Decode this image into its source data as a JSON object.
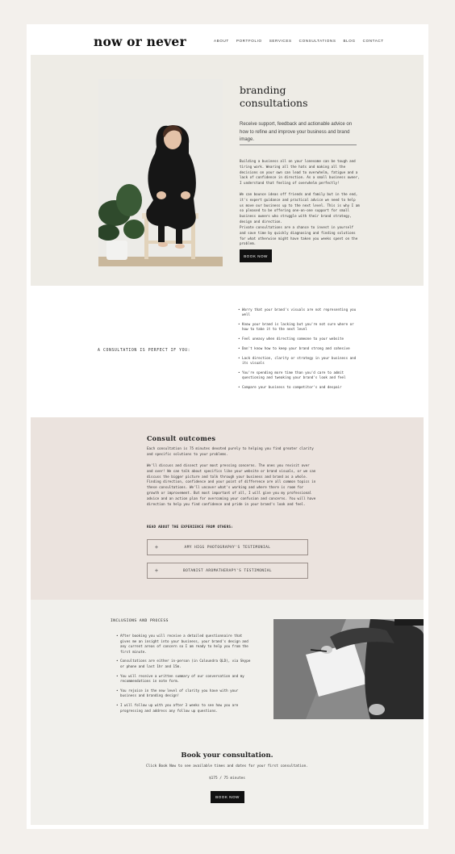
{
  "header": {
    "logo": "now or never",
    "nav": [
      "ABOUT",
      "PORTFOLIO",
      "SERVICES",
      "CONSULTATIONS",
      "BLOG",
      "CONTACT"
    ]
  },
  "hero": {
    "title_line1": "branding",
    "title_line2": "consultations",
    "subtitle": "Receive support, feedback and actionable advice on how to refine and improve your business and brand image.",
    "paragraphs": [
      "Building a business all on your lonesome can be tough and tiring work. Wearing all the hats and making all the decisions on your own can lead to overwhelm, fatigue and a lack of confidence in direction. As a small business owner, I understand that feeling of overwhelm perfectly!",
      "We can bounce ideas off friends and family but in the end, it's expert guidance and practical advice we need to help us move our business up to the next level. This is why I am so pleased to be offering one-on-one support for small business owners who struggle with their brand strategy, design and direction.",
      "Private consultations are a chance to invest in yourself and save time by quickly diagnosing and finding solutions for what otherwise might have taken you weeks spent on the problem."
    ],
    "button": "BOOK NOW"
  },
  "perfect_if": {
    "label": "A CONSULTATION IS PERFECT IF YOU:",
    "items": [
      "Worry that your brand's visuals are not representing you well",
      "Know your brand is lacking but you're not sure where or how to take it to the next level",
      "Feel uneasy when directing someone to your website",
      "Don't know how to keep your brand strong and cohesive",
      "Lack direction, clarity or strategy in your business and its visuals",
      "You're spending more time than you'd care to admit questioning and tweaking your brand's look and feel",
      "Compare your business to competitor's and despair"
    ]
  },
  "outcomes": {
    "title": "Consult outcomes",
    "paragraphs": [
      "Each consultation is 75 minutes devoted purely to helping you find greater clarity and specific solutions to your problems.",
      "We'll discuss and dissect your most pressing concerns. The ones you revisit over and over! We can talk about specifics like your website or brand visuals, or we can discuss the bigger picture and talk through your business and brand as a whole. Finding direction, confidence and your point of difference are all common topics in these consultations. We'll uncover what's working and where there is room for growth or improvement. But most important of all, I will give you my professional advice and an action plan for overcoming your confusion and concerns. You will have direction to help you find confidence and pride in your brand's look and feel."
    ],
    "read_label": "READ ABOUT THE EXPERIENCE FROM OTHERS:",
    "testimonials": [
      "AMY HIGG PHOTOGRAPHY'S TESTIMONIAL",
      "BOTANIST AROMATHERAPY'S TESTIMONIAL"
    ]
  },
  "inclusions": {
    "title": "INCLUSIONS AND PROCESS",
    "items": [
      "After booking you will receive a detailed questionnaire that gives me an insight into your business, your brand's design and any current areas of concern so I am ready to help you from the first minute.",
      "Consultations are either in-person (in Caloundra QLD), via Skype or phone and last 1hr and 15m.",
      "You will receive a written summary of our conversation and my recommendations in note form.",
      "You rejoice in the new level of clarity you have with your business and branding design!",
      "I will follow up with you after 3 weeks to see how you are progressing and address any follow up questions."
    ]
  },
  "booking": {
    "title": "Book your consultation.",
    "subtitle": "Click Book Now to see available times and dates for your first consultation.",
    "price": "$175 / 75 minutes",
    "button": "BOOK NOW"
  },
  "colors": {
    "page_bg": "#f3f0ec",
    "hero_bg": "#eeece6",
    "outcomes_bg": "#ebe3de",
    "button_bg": "#111111"
  }
}
